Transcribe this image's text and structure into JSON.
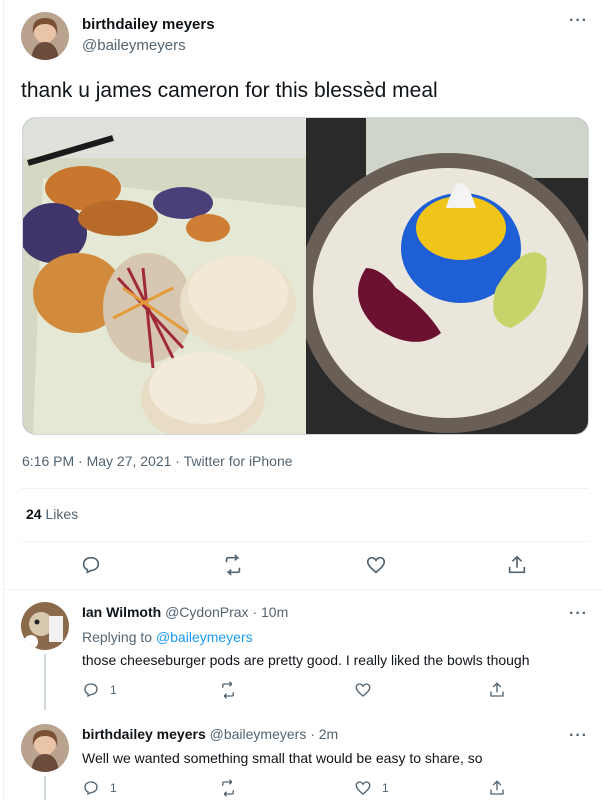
{
  "tweet": {
    "author_name": "birthdailey meyers",
    "author_handle": "@baileymeyers",
    "text": "thank u james cameron for this blessèd meal",
    "timestamp": "6:16 PM · May 27, 2021 · Twitter for iPhone",
    "likes_count": "24",
    "likes_label": "Likes",
    "more_label": "···",
    "media": [
      {
        "name": "food-plate-photo"
      },
      {
        "name": "dessert-plate-photo"
      }
    ]
  },
  "replies": [
    {
      "author_name": "Ian Wilmoth",
      "author_handle": "@CydonPrax",
      "time": "· 10m",
      "replying_label": "Replying to",
      "replying_to": "@baileymeyers",
      "text": "those cheeseburger pods are pretty good. I really liked the bowls though",
      "reply_count": "1",
      "retweet_count": "",
      "like_count": ""
    },
    {
      "author_name": "birthdailey meyers",
      "author_handle": "@baileymeyers",
      "time": "· 2m",
      "text": "Well we wanted something small that would be easy to share, so",
      "reply_count": "1",
      "retweet_count": "",
      "like_count": "1"
    }
  ],
  "icons": [
    "reply-icon",
    "retweet-icon",
    "like-icon",
    "share-icon",
    "more-icon"
  ],
  "colors": {
    "accent": "#1d9bf0",
    "muted": "#536471",
    "text": "#0f1419"
  }
}
